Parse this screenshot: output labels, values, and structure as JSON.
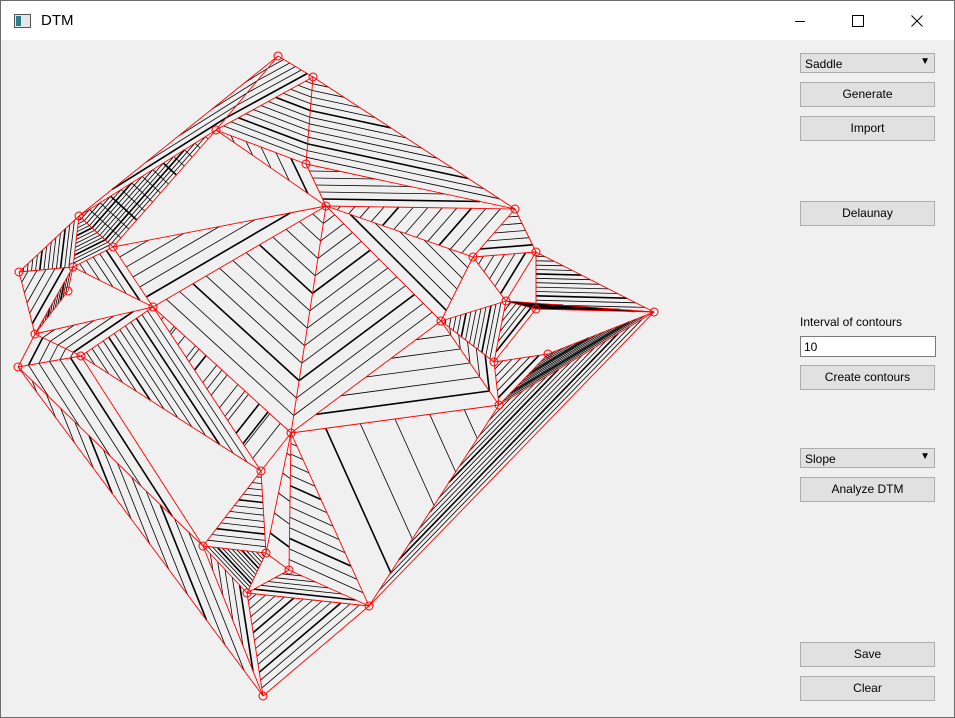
{
  "window": {
    "title": "DTM"
  },
  "controls": {
    "method_select": "Saddle",
    "generate_label": "Generate",
    "import_label": "Import",
    "delaunay_label": "Delaunay",
    "interval_label": "Interval of contours",
    "interval_value": "10",
    "create_contours_label": "Create contours",
    "analysis_select": "Slope",
    "analyze_label": "Analyze DTM",
    "save_label": "Save",
    "clear_label": "Clear"
  },
  "colors": {
    "triangulation": "#ff0000",
    "contours": "#000000",
    "background": "#f0f0f0"
  },
  "icons": {
    "app": "window-app-icon",
    "minimize": "minimize-icon",
    "maximize": "maximize-icon",
    "close": "close-icon",
    "dropdown": "chevron-down-icon"
  }
}
